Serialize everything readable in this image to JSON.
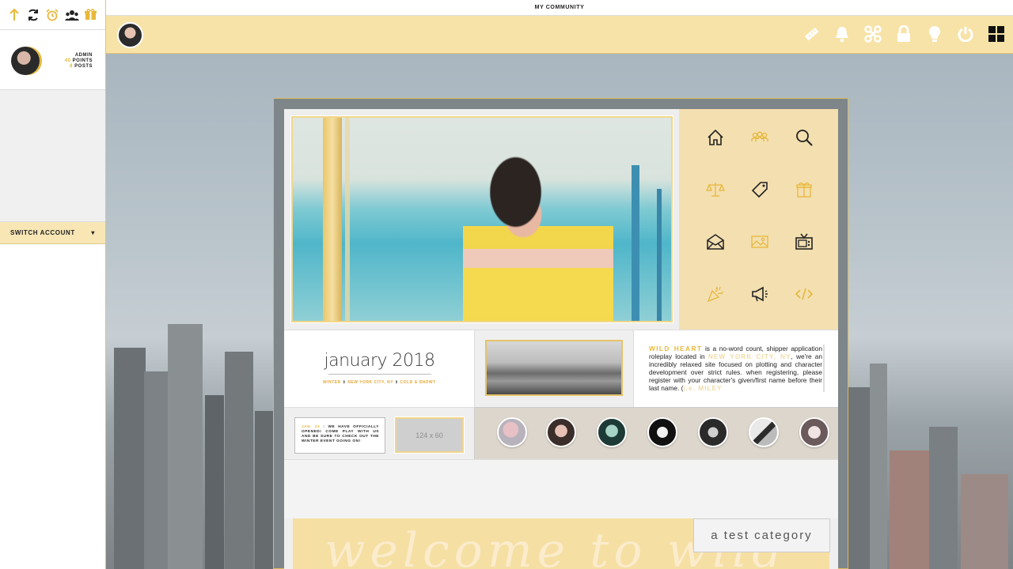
{
  "topbar": {
    "title": "MY COMMUNITY"
  },
  "sidebar": {
    "icons": [
      "arrow-up-icon",
      "refresh-icon",
      "alarm-clock-icon",
      "group-icon",
      "gift-icon"
    ],
    "profile": {
      "role": "ADMIN",
      "points_value": "40",
      "points_label": "POINTS",
      "posts_value": "8",
      "posts_label": "POSTS"
    },
    "switch_account": "SWITCH ACCOUNT",
    "switch_caret": "▾"
  },
  "navbar": {
    "icons": [
      "ruler-icon",
      "bell-icon",
      "scissors-icon",
      "lock-icon",
      "bulb-icon",
      "power-icon",
      "grid-icon"
    ]
  },
  "icon_panel": {
    "icons": [
      "home-icon",
      "members-icon",
      "search-icon",
      "scales-icon",
      "tag-icon",
      "gift-icon",
      "envelope-icon",
      "image-icon",
      "tv-icon",
      "party-popper-icon",
      "megaphone-icon",
      "code-icon"
    ]
  },
  "date_panel": {
    "title": "january 2018",
    "season": "WINTER",
    "location": "NEW YORK CITY, NY",
    "weather": "COLD & SNOWY",
    "separator": "⇕"
  },
  "description": {
    "site_name": "WILD HEART",
    "text_1": " is a no-word count, shipper application roleplay located in ",
    "location": "NEW YORK CITY, NY",
    "text_2": ", we're an incredibly relaxed site focused on plotting and character development over strict rules. when registering, please register with your character's given/first name before their last name. (",
    "example": "i.e. MILEY"
  },
  "news": {
    "date": "JAN. 01",
    "text": " : WE HAVE OFFICIALLY OPENED! COME PLAY WITH US AND BE SURE TO CHECK OUT THE WINTER EVENT GOING ON!"
  },
  "ad": {
    "label": "124 x 60"
  },
  "category": {
    "script": "welcome to wild",
    "label": "a test category"
  },
  "colors": {
    "accent": "#e8b83a",
    "nav_bg": "#f7e3a8",
    "icon_panel_bg": "#f3dfb0"
  }
}
